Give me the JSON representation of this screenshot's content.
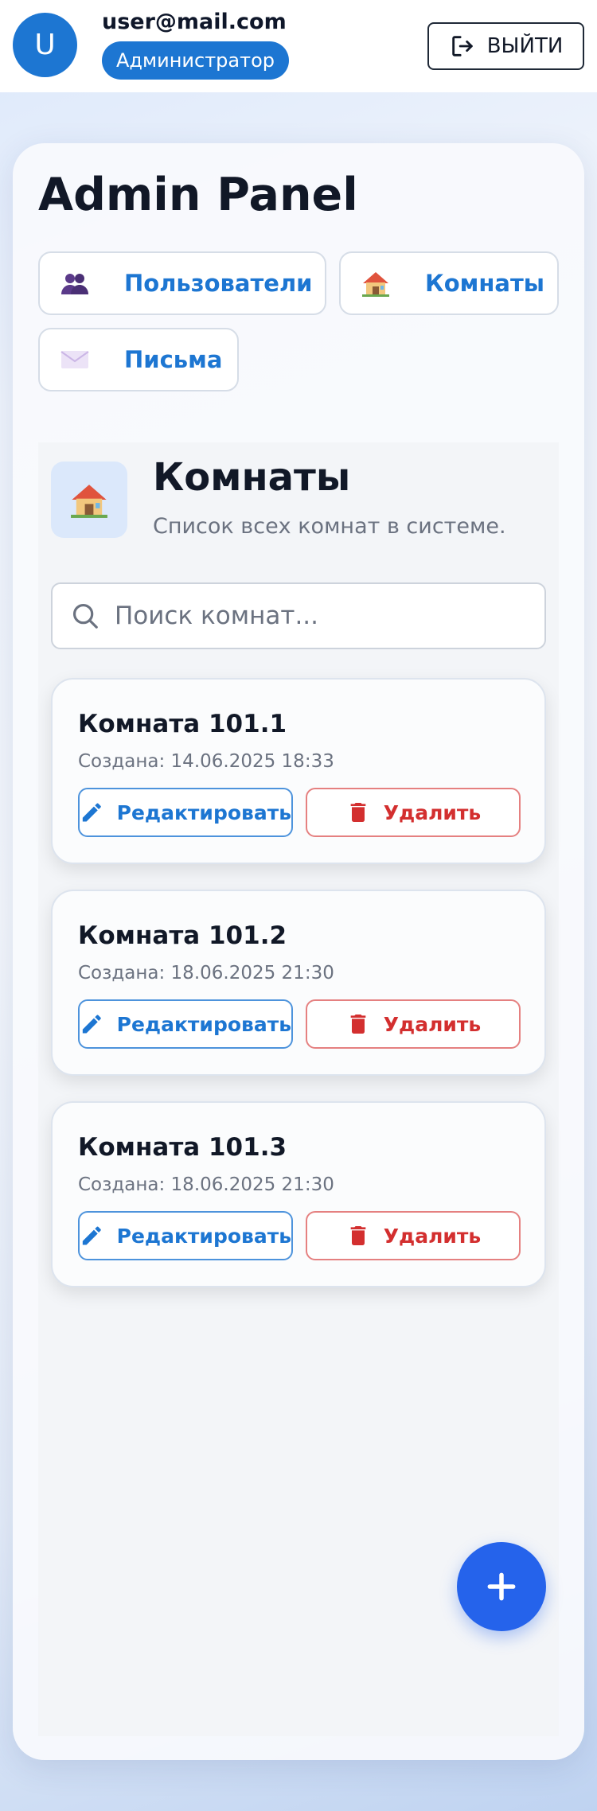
{
  "header": {
    "avatar_letter": "U",
    "user_email": "user@mail.com",
    "role": "Администратор",
    "logout_label": "ВЫЙТИ"
  },
  "panel": {
    "title": "Admin Panel",
    "nav": [
      {
        "label": "Пользователи",
        "icon": "users-icon"
      },
      {
        "label": "Комнаты",
        "icon": "house-icon"
      },
      {
        "label": "Письма",
        "icon": "envelope-icon"
      }
    ]
  },
  "section": {
    "title": "Комнаты",
    "subtitle": "Список всех комнат в системе.",
    "icon": "house-icon"
  },
  "search": {
    "placeholder": "Поиск комнат...",
    "value": ""
  },
  "rooms": [
    {
      "name": "Комната 101.1",
      "created": "Создана: 14.06.2025 18:33",
      "edit_label": "Редактировать",
      "delete_label": "Удалить"
    },
    {
      "name": "Комната 101.2",
      "created": "Создана: 18.06.2025 21:30",
      "edit_label": "Редактировать",
      "delete_label": "Удалить"
    },
    {
      "name": "Комната 101.3",
      "created": "Создана: 18.06.2025 21:30",
      "edit_label": "Редактировать",
      "delete_label": "Удалить"
    }
  ],
  "fab": {
    "icon": "plus-icon"
  },
  "colors": {
    "primary": "#1d76d2",
    "danger": "#d32f2f",
    "fab": "#2563eb"
  }
}
